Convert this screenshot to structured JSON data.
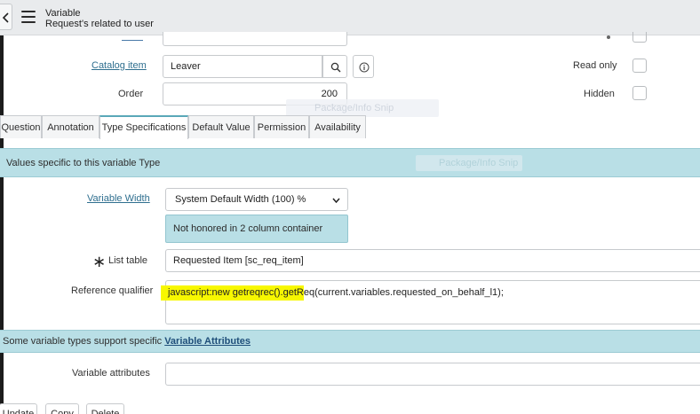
{
  "header": {
    "title": "Variable",
    "subtitle": "Request's related to user",
    "back_icon": "chevron-left-icon",
    "menu_icon": "hamburger-menu-icon"
  },
  "fields": {
    "catalog_item": {
      "label": "Catalog item",
      "value": "Leaver"
    },
    "order": {
      "label": "Order",
      "value": "200"
    },
    "read_only": {
      "label": "Read only"
    },
    "hidden": {
      "label": "Hidden"
    }
  },
  "tabs": [
    {
      "label": "Question"
    },
    {
      "label": "Annotation"
    },
    {
      "label": "Type Specifications"
    },
    {
      "label": "Default Value"
    },
    {
      "label": "Permission"
    },
    {
      "label": "Availability"
    }
  ],
  "active_tab": "Type Specifications",
  "type_specs": {
    "band_text": "Values specific to this variable Type",
    "variable_width_label": "Variable Width",
    "variable_width_value": "System Default Width (100) %",
    "info_message": "Not honored in 2 column container",
    "list_table_label": "List table",
    "list_table_value": "Requested Item [sc_req_item]",
    "reference_qualifier_label": "Reference qualifier",
    "reference_qualifier_highlighted": "javascript:new getreqrec().getR",
    "reference_qualifier_rest": "eq(current.variables.requested_on_behalf_l1);"
  },
  "attributes": {
    "band_prefix": "Some variable types support specific ",
    "band_link": "Variable Attributes",
    "label": "Variable attributes",
    "value": ""
  },
  "buttons": {
    "update": "Update",
    "copy": "Copy",
    "delete": "Delete"
  },
  "ghost_overlays": {
    "first": "Package/Info Snip",
    "second": "Package/Info Snip"
  },
  "colors": {
    "header_bg": "#e9ebed",
    "panel_band": "#b9dfe6",
    "active_tab_accent": "#5aa8b8",
    "link": "#2f6f8f",
    "highlight": "#f7f700"
  }
}
